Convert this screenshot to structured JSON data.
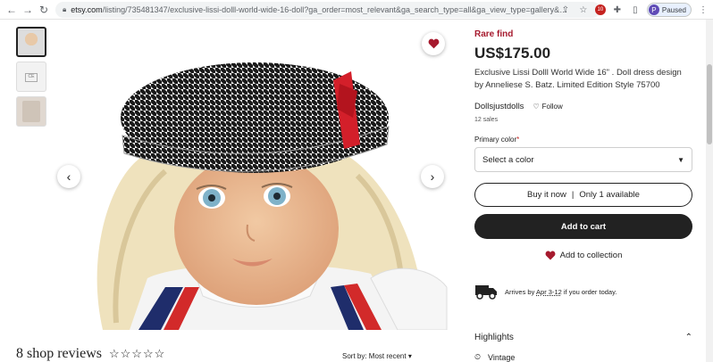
{
  "browser": {
    "url_domain": "etsy.com",
    "url_path": "/listing/735481347/exclusive-lissi-dolll-world-wide-16-doll?ga_order=most_relevant&ga_search_type=all&ga_view_type=gallery&ga_search...",
    "profile_status": "Paused",
    "profile_initial": "P",
    "badge_count": "10"
  },
  "listing": {
    "rare_label": "Rare find",
    "price": "US$175.00",
    "title": "Exclusive Lissi Dolll World Wide 16\" . Doll dress design by Anneliese S. Batz. Limited Edition Style 75700",
    "shop_name": "Dollsjustdolls",
    "follow_label": "Follow",
    "sales": "12 sales",
    "primary_color_label": "Primary color",
    "required_mark": "*",
    "select_placeholder": "Select a color",
    "buy_now_label": "Buy it now",
    "availability": "Only 1 available",
    "add_to_cart_label": "Add to cart",
    "add_to_collection_label": "Add to collection",
    "arrives_prefix": "Arrives by",
    "arrives_dates": "Apr 3-12",
    "arrives_suffix": "if you order today.",
    "highlights_label": "Highlights",
    "vintage_label": "Vintage"
  },
  "reviews": {
    "title": "8 shop reviews",
    "stars": "☆☆☆☆☆",
    "sort_label": "Sort by: Most recent"
  },
  "colors": {
    "rare": "#a61a2e",
    "cart_bg": "#222222",
    "heart": "#a61a2e"
  }
}
